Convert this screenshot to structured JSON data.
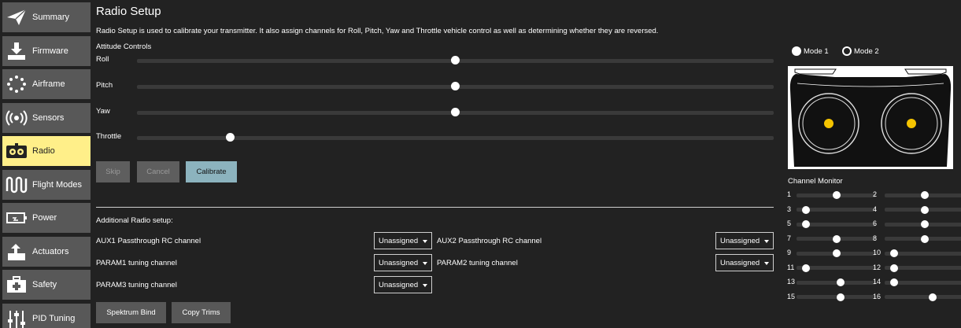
{
  "sidebar": {
    "items": [
      {
        "label": "Summary",
        "icon": "paper-plane-icon",
        "active": false
      },
      {
        "label": "Firmware",
        "icon": "download-icon",
        "active": false
      },
      {
        "label": "Airframe",
        "icon": "airframe-dots-icon",
        "active": false
      },
      {
        "label": "Sensors",
        "icon": "radio-waves-icon",
        "active": false
      },
      {
        "label": "Radio",
        "icon": "radio-icon",
        "active": true
      },
      {
        "label": "Flight Modes",
        "icon": "wave-icon",
        "active": false
      },
      {
        "label": "Power",
        "icon": "battery-icon",
        "active": false
      },
      {
        "label": "Actuators",
        "icon": "actuator-icon",
        "active": false
      },
      {
        "label": "Safety",
        "icon": "medkit-icon",
        "active": false
      },
      {
        "label": "PID Tuning",
        "icon": "sliders-icon",
        "active": false
      }
    ]
  },
  "page": {
    "title": "Radio Setup",
    "description": "Radio Setup is used to calibrate your transmitter. It also assign channels for Roll, Pitch, Yaw and Throttle vehicle control as well as determining whether they are reversed.",
    "attitude_label": "Attitude Controls",
    "attitude": [
      {
        "label": "Roll",
        "value": 0.5
      },
      {
        "label": "Pitch",
        "value": 0.5
      },
      {
        "label": "Yaw",
        "value": 0.5
      },
      {
        "label": "Throttle",
        "value": 0.147
      }
    ],
    "buttons": {
      "skip": "Skip",
      "cancel": "Cancel",
      "calibrate": "Calibrate"
    },
    "additional_label": "Additional Radio setup:",
    "params": [
      {
        "label": "AUX1 Passthrough RC channel",
        "value": "Unassigned"
      },
      {
        "label": "AUX2 Passthrough RC channel",
        "value": "Unassigned"
      },
      {
        "label": "PARAM1 tuning channel",
        "value": "Unassigned"
      },
      {
        "label": "PARAM2 tuning channel",
        "value": "Unassigned"
      },
      {
        "label": "PARAM3 tuning channel",
        "value": "Unassigned"
      }
    ],
    "bottom_buttons": {
      "spektrum": "Spektrum Bind",
      "copy_trims": "Copy Trims"
    }
  },
  "right_panel": {
    "modes": [
      {
        "label": "Mode 1",
        "checked": false
      },
      {
        "label": "Mode 2",
        "checked": true
      }
    ],
    "stick_color": "#f5c400",
    "channel_monitor_label": "Channel Monitor",
    "channels": [
      {
        "num": "1",
        "value": 0.5
      },
      {
        "num": "2",
        "value": 0.5
      },
      {
        "num": "3",
        "value": 0.12
      },
      {
        "num": "4",
        "value": 0.5
      },
      {
        "num": "5",
        "value": 0.12
      },
      {
        "num": "6",
        "value": 0.5
      },
      {
        "num": "7",
        "value": 0.5
      },
      {
        "num": "8",
        "value": 0.5
      },
      {
        "num": "9",
        "value": 0.5
      },
      {
        "num": "10",
        "value": 0.12
      },
      {
        "num": "11",
        "value": 0.12
      },
      {
        "num": "12",
        "value": 0.12
      },
      {
        "num": "13",
        "value": 0.55
      },
      {
        "num": "14",
        "value": 0.12
      },
      {
        "num": "15",
        "value": 0.55
      },
      {
        "num": "16",
        "value": 0.6
      }
    ]
  },
  "colors": {
    "background": "#222222",
    "nav_item": "#585858",
    "nav_active": "#ffef89",
    "primary_button": "#8cb3be"
  }
}
